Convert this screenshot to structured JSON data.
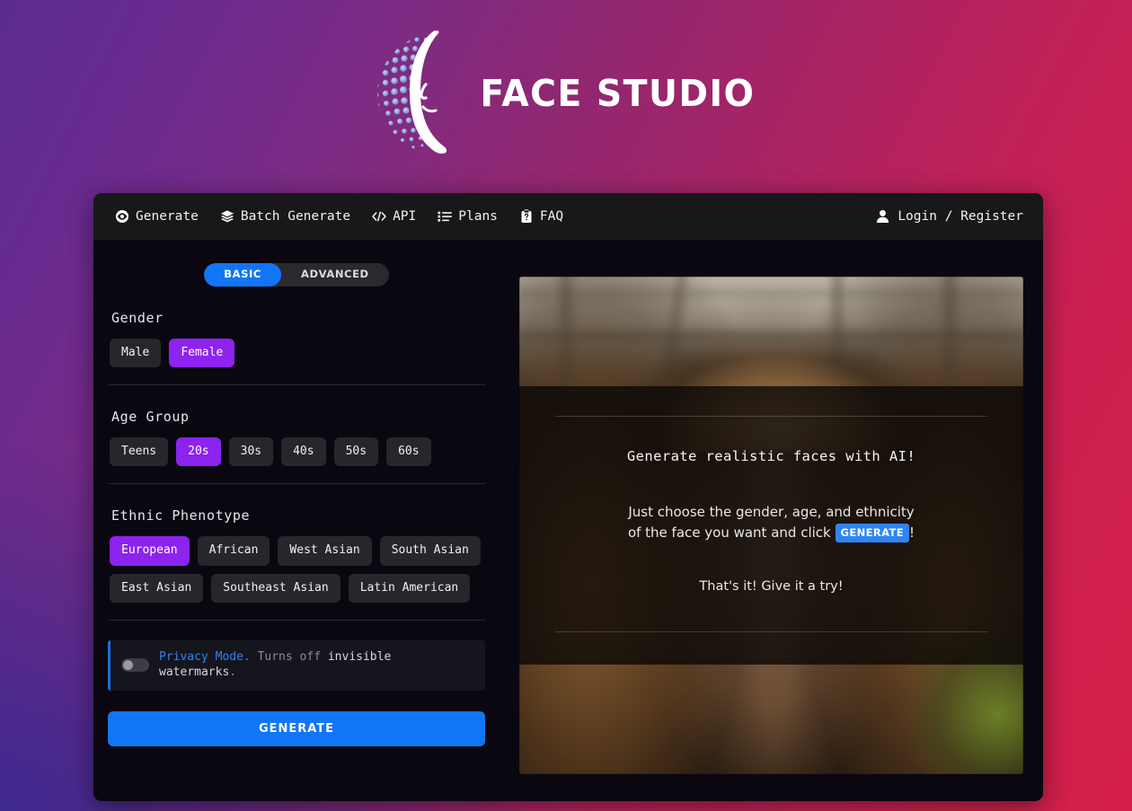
{
  "brand": {
    "name": "FACE STUDIO",
    "logo_icon": "dotted-sphere-face-profile-logo"
  },
  "colors": {
    "accent_blue": "#1176f5",
    "accent_purple": "#8c23ef",
    "navbar_bg": "#18181b",
    "card_bg": "#0a0710",
    "chip_bg": "#27272b",
    "bg_gradient_start": "#5b2c8d",
    "bg_gradient_end": "#d41f4a"
  },
  "navbar": {
    "items": [
      {
        "label": "Generate",
        "icon": "eye-icon"
      },
      {
        "label": "Batch Generate",
        "icon": "layers-icon"
      },
      {
        "label": "API",
        "icon": "code-icon"
      },
      {
        "label": "Plans",
        "icon": "list-icon"
      },
      {
        "label": "FAQ",
        "icon": "clipboard-question-icon"
      }
    ],
    "account": {
      "label": "Login / Register",
      "icon": "user-icon"
    }
  },
  "mode_tabs": {
    "options": [
      "BASIC",
      "ADVANCED"
    ],
    "selected": "BASIC"
  },
  "form": {
    "sections": [
      {
        "title": "Gender",
        "options": [
          "Male",
          "Female"
        ],
        "selected": "Female"
      },
      {
        "title": "Age Group",
        "options": [
          "Teens",
          "20s",
          "30s",
          "40s",
          "50s",
          "60s"
        ],
        "selected": "20s"
      },
      {
        "title": "Ethnic Phenotype",
        "options": [
          "European",
          "African",
          "West Asian",
          "South Asian",
          "East Asian",
          "Southeast Asian",
          "Latin American"
        ],
        "selected": "European"
      }
    ],
    "privacy": {
      "toggle_state": "off",
      "label": "Privacy Mode.",
      "text_muted": " Turns off ",
      "text_emphasis": "invisible watermarks",
      "text_end": "."
    },
    "generate_button": "GENERATE"
  },
  "preview": {
    "title": "Generate realistic faces with AI!",
    "subtitle_part1": "Just choose the gender, age, and ethnicity of the face you want and click",
    "subtitle_pill": "GENERATE",
    "subtitle_part2": "!",
    "footer": "That's it! Give it a try!",
    "image_alt": "blonde-woman-smiling-photo"
  }
}
